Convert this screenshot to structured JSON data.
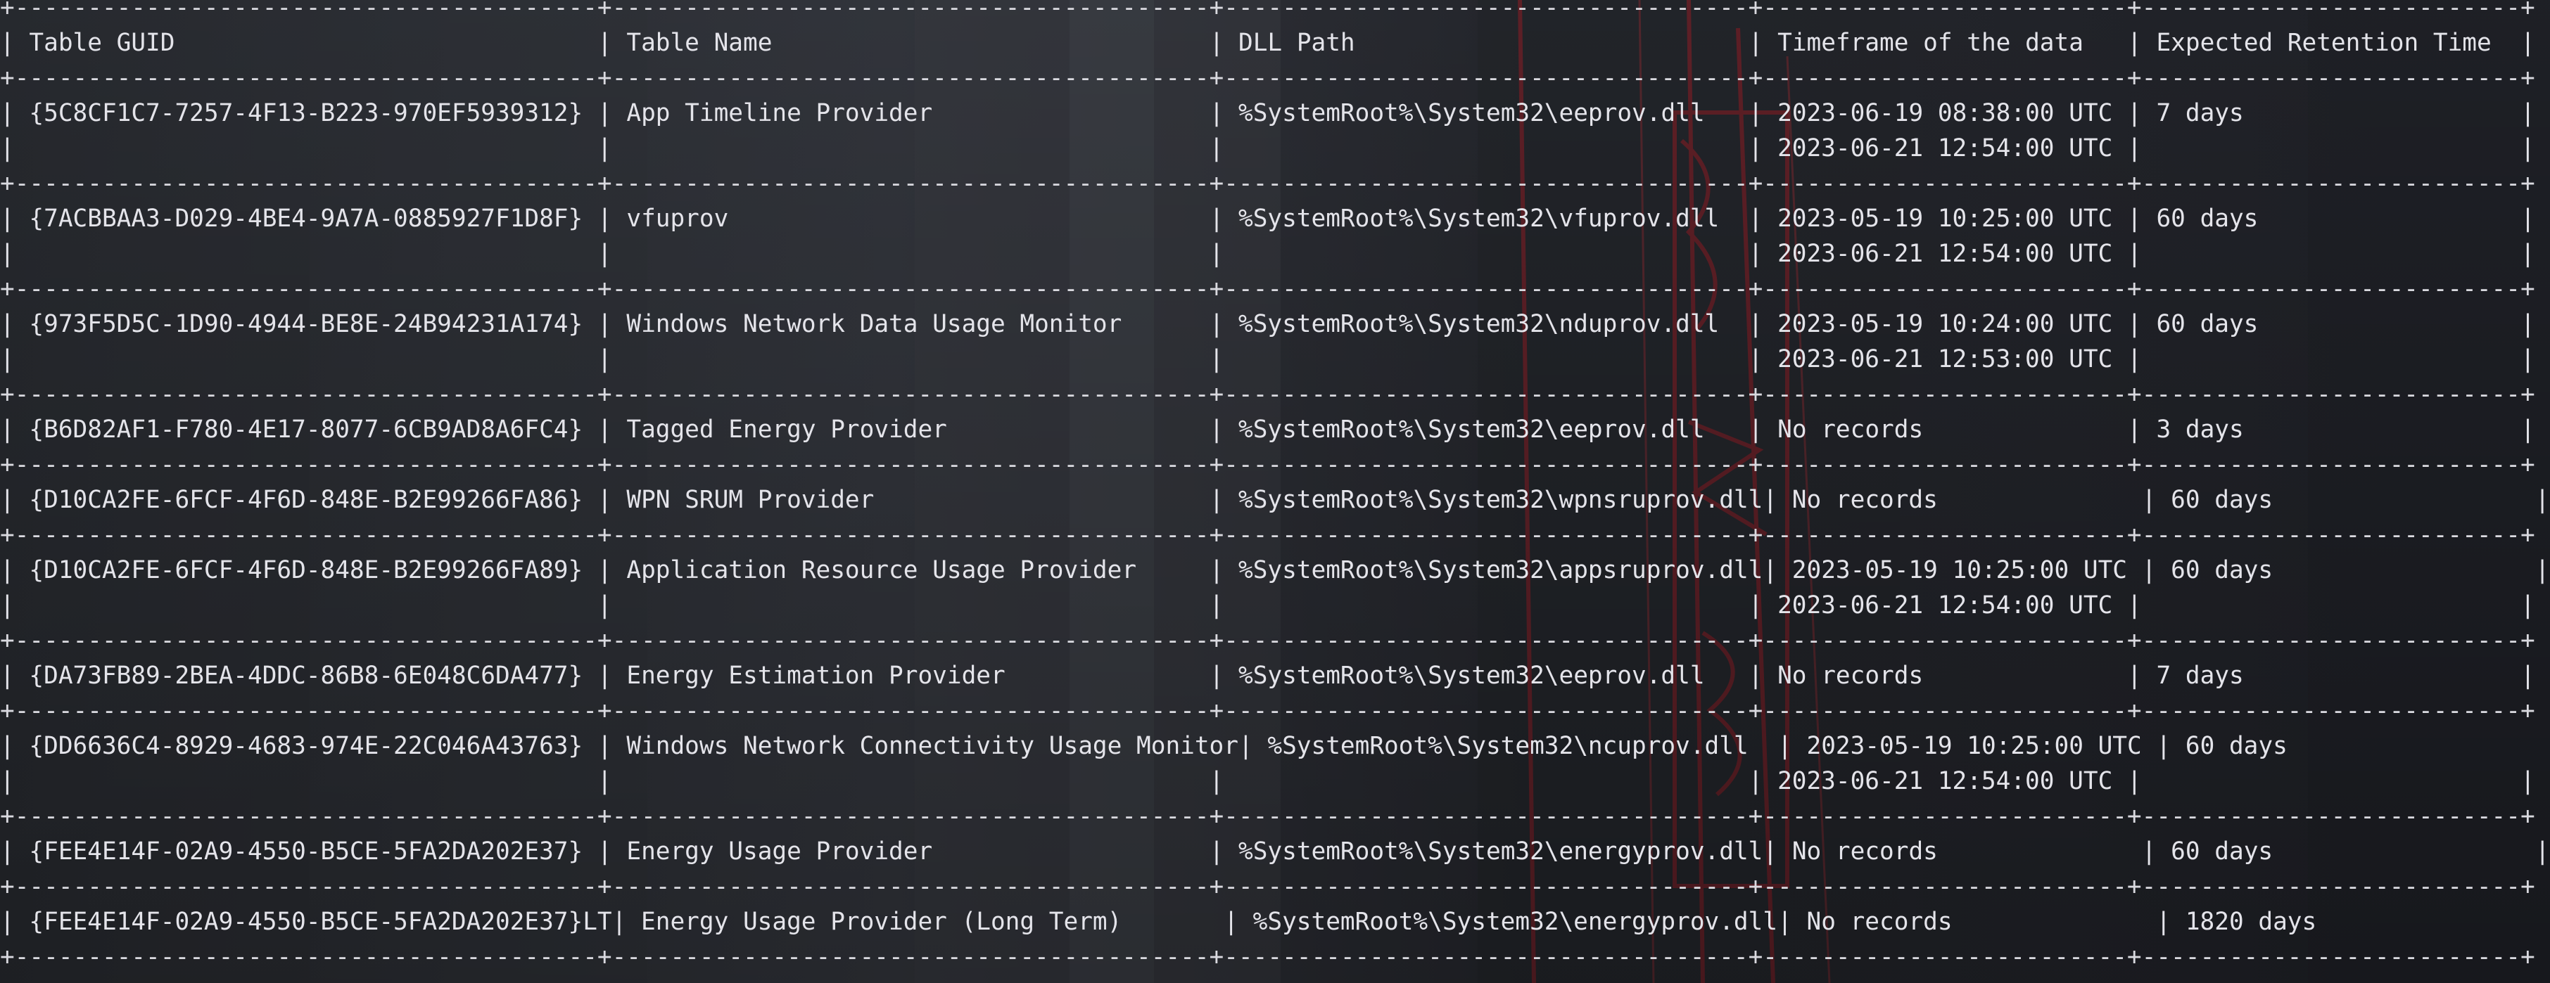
{
  "table": {
    "headers": [
      "Table GUID",
      "Table Name",
      "DLL Path",
      "Timeframe of the data",
      "Expected Retention Time"
    ],
    "rows": [
      {
        "guid": "{5C8CF1C7-7257-4F13-B223-970EF5939312}",
        "name": "App Timeline Provider",
        "dll": "%SystemRoot%\\System32\\eeprov.dll",
        "timeframe": [
          "2023-06-19 08:38:00 UTC",
          "2023-06-21 12:54:00 UTC"
        ],
        "retention": "7 days"
      },
      {
        "guid": "{7ACBBAA3-D029-4BE4-9A7A-0885927F1D8F}",
        "name": "vfuprov",
        "dll": "%SystemRoot%\\System32\\vfuprov.dll",
        "timeframe": [
          "2023-05-19 10:25:00 UTC",
          "2023-06-21 12:54:00 UTC"
        ],
        "retention": "60 days"
      },
      {
        "guid": "{973F5D5C-1D90-4944-BE8E-24B94231A174}",
        "name": "Windows Network Data Usage Monitor",
        "dll": "%SystemRoot%\\System32\\nduprov.dll",
        "timeframe": [
          "2023-05-19 10:24:00 UTC",
          "2023-06-21 12:53:00 UTC"
        ],
        "retention": "60 days"
      },
      {
        "guid": "{B6D82AF1-F780-4E17-8077-6CB9AD8A6FC4}",
        "name": "Tagged Energy Provider",
        "dll": "%SystemRoot%\\System32\\eeprov.dll",
        "timeframe": [
          "No records"
        ],
        "retention": "3 days"
      },
      {
        "guid": "{D10CA2FE-6FCF-4F6D-848E-B2E99266FA86}",
        "name": "WPN SRUM Provider",
        "dll": "%SystemRoot%\\System32\\wpnsruprov.dll",
        "timeframe": [
          "No records"
        ],
        "retention": "60 days"
      },
      {
        "guid": "{D10CA2FE-6FCF-4F6D-848E-B2E99266FA89}",
        "name": "Application Resource Usage Provider",
        "dll": "%SystemRoot%\\System32\\appsruprov.dll",
        "timeframe": [
          "2023-05-19 10:25:00 UTC",
          "2023-06-21 12:54:00 UTC"
        ],
        "retention": "60 days"
      },
      {
        "guid": "{DA73FB89-2BEA-4DDC-86B8-6E048C6DA477}",
        "name": "Energy Estimation Provider",
        "dll": "%SystemRoot%\\System32\\eeprov.dll",
        "timeframe": [
          "No records"
        ],
        "retention": "7 days"
      },
      {
        "guid": "{DD6636C4-8929-4683-974E-22C046A43763}",
        "name": "Windows Network Connectivity Usage Monitor",
        "dll": "%SystemRoot%\\System32\\ncuprov.dll",
        "timeframe": [
          "2023-05-19 10:25:00 UTC",
          "2023-06-21 12:54:00 UTC"
        ],
        "retention": "60 days"
      },
      {
        "guid": "{FEE4E14F-02A9-4550-B5CE-5FA2DA202E37}",
        "name": "Energy Usage Provider",
        "dll": "%SystemRoot%\\System32\\energyprov.dll",
        "timeframe": [
          "No records"
        ],
        "retention": "60 days"
      },
      {
        "guid": "{FEE4E14F-02A9-4550-B5CE-5FA2DA202E37}LT",
        "name": "Energy Usage Provider (Long Term)",
        "dll": "%SystemRoot%\\System32\\energyprov.dll",
        "timeframe": [
          "No records"
        ],
        "retention": "1820 days"
      }
    ]
  },
  "colors": {
    "background": "#2a2c35",
    "text": "#e4e4ea",
    "neon_accent": "#b3202a"
  }
}
